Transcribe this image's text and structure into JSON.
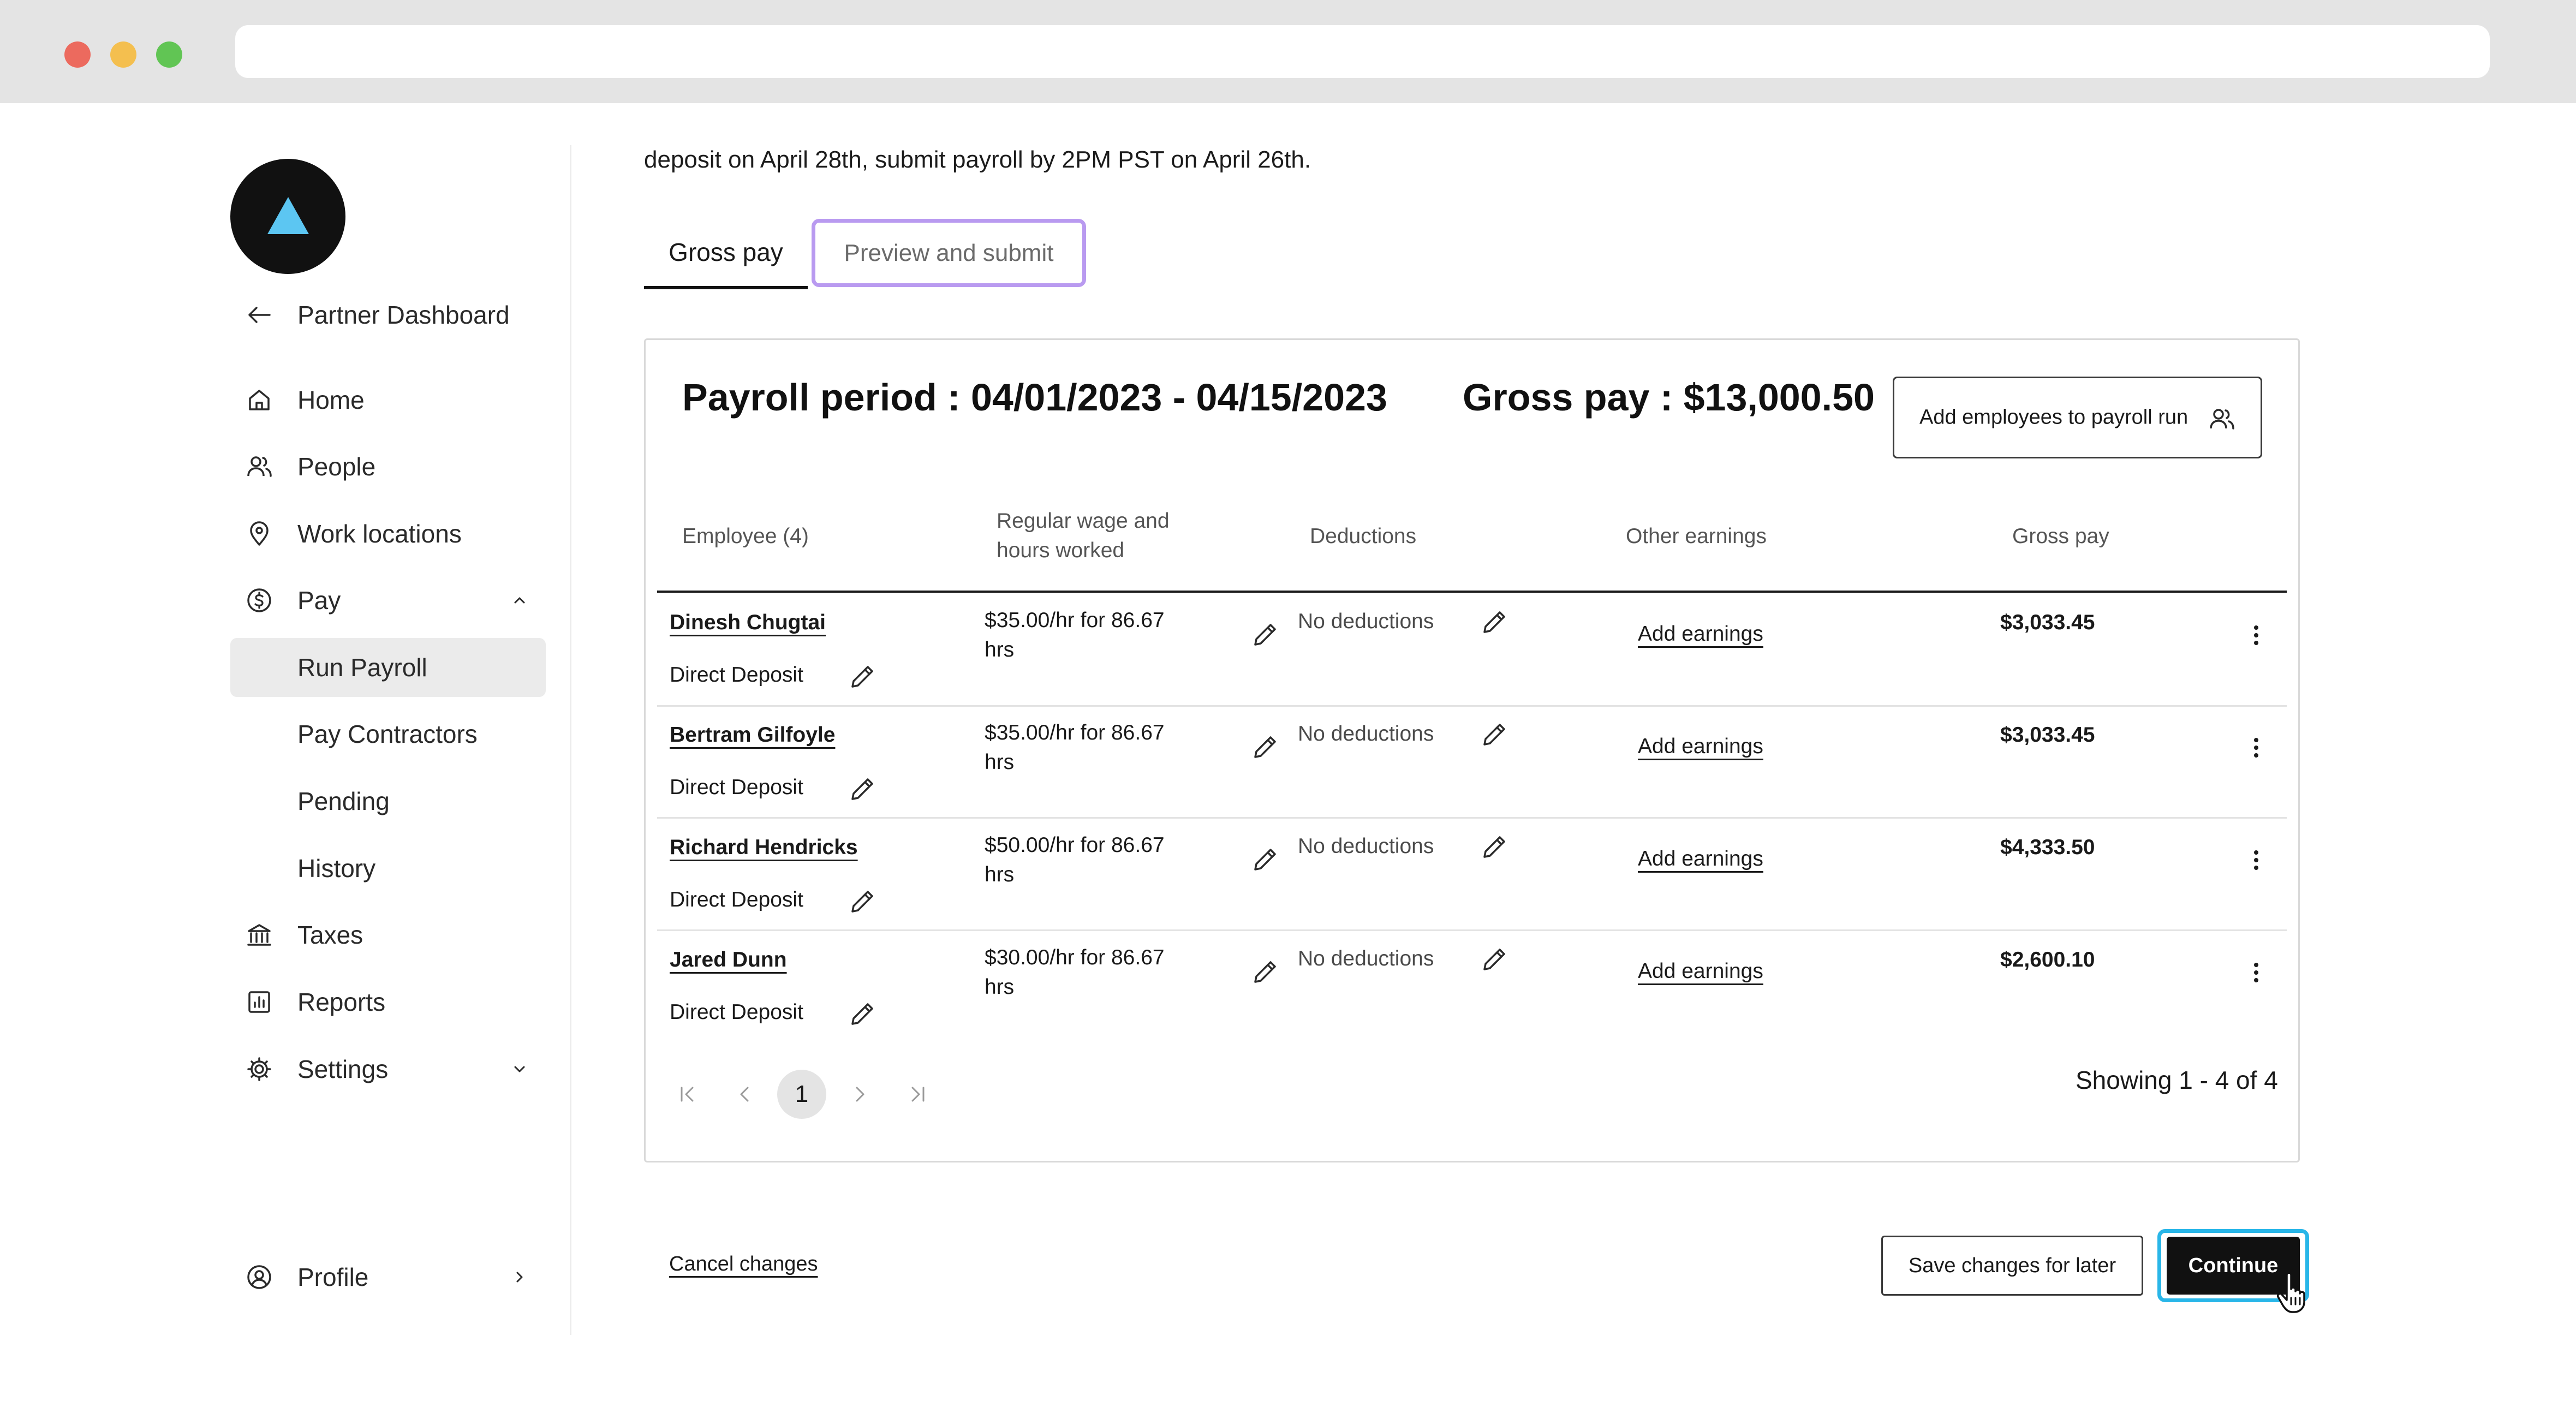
{
  "colors": {
    "accent_cyan": "#29b6e8",
    "tab_focus_purple": "#b99af0",
    "logo_triangle": "#5cc6f2",
    "primary_button": "#111111"
  },
  "sidebar": {
    "back_link": {
      "label": "Partner Dashboard",
      "icon": "arrow-left-icon"
    },
    "items": [
      {
        "label": "Home",
        "icon": "home-icon"
      },
      {
        "label": "People",
        "icon": "people-icon"
      },
      {
        "label": "Work locations",
        "icon": "location-pin-icon"
      },
      {
        "label": "Pay",
        "icon": "dollar-circle-icon",
        "expanded": true
      },
      {
        "label": "Run Payroll",
        "active": true
      },
      {
        "label": "Pay Contractors"
      },
      {
        "label": "Pending"
      },
      {
        "label": "History"
      },
      {
        "label": "Taxes",
        "icon": "bank-icon"
      },
      {
        "label": "Reports",
        "icon": "chart-icon"
      },
      {
        "label": "Settings",
        "icon": "gear-icon"
      }
    ],
    "profile": {
      "label": "Profile",
      "icon": "user-circle-icon"
    }
  },
  "main": {
    "intro_text": "deposit on April 28th, submit payroll by 2PM PST on April 26th.",
    "tabs": [
      {
        "label": "Gross pay",
        "selected": true
      },
      {
        "label": "Preview and submit",
        "selected": false
      }
    ],
    "summary": {
      "period": "Payroll period : 04/01/2023 - 04/15/2023",
      "gross_pay": "Gross pay : $13,000.50",
      "add_employees_label": "Add employees to payroll run"
    },
    "table": {
      "headers": {
        "employee": "Employee (4)",
        "wage_line1": "Regular wage and",
        "wage_line2": "hours worked",
        "deductions": "Deductions",
        "other_earnings": "Other earnings",
        "gross_pay": "Gross pay"
      },
      "rows": [
        {
          "name": "Dinesh Chugtai",
          "payment": "Direct Deposit",
          "wage_line1": "$35.00/hr for 86.67",
          "wage_line2": "hrs",
          "deductions": "No deductions",
          "earnings": "Add earnings",
          "gross": "$3,033.45"
        },
        {
          "name": "Bertram Gilfoyle",
          "payment": "Direct Deposit",
          "wage_line1": "$35.00/hr for 86.67",
          "wage_line2": "hrs",
          "deductions": "No deductions",
          "earnings": "Add earnings",
          "gross": "$3,033.45"
        },
        {
          "name": "Richard Hendricks",
          "payment": "Direct Deposit",
          "wage_line1": "$50.00/hr for 86.67",
          "wage_line2": "hrs",
          "deductions": "No deductions",
          "earnings": "Add earnings",
          "gross": "$4,333.50"
        },
        {
          "name": "Jared Dunn",
          "payment": "Direct Deposit",
          "wage_line1": "$30.00/hr for 86.67",
          "wage_line2": "hrs",
          "deductions": "No deductions",
          "earnings": "Add earnings",
          "gross": "$2,600.10"
        }
      ]
    },
    "pagination": {
      "current_page": "1",
      "showing": "Showing 1 - 4 of 4"
    },
    "footer": {
      "cancel_label": "Cancel changes",
      "save_label": "Save changes for later",
      "continue_label": "Continue"
    }
  }
}
